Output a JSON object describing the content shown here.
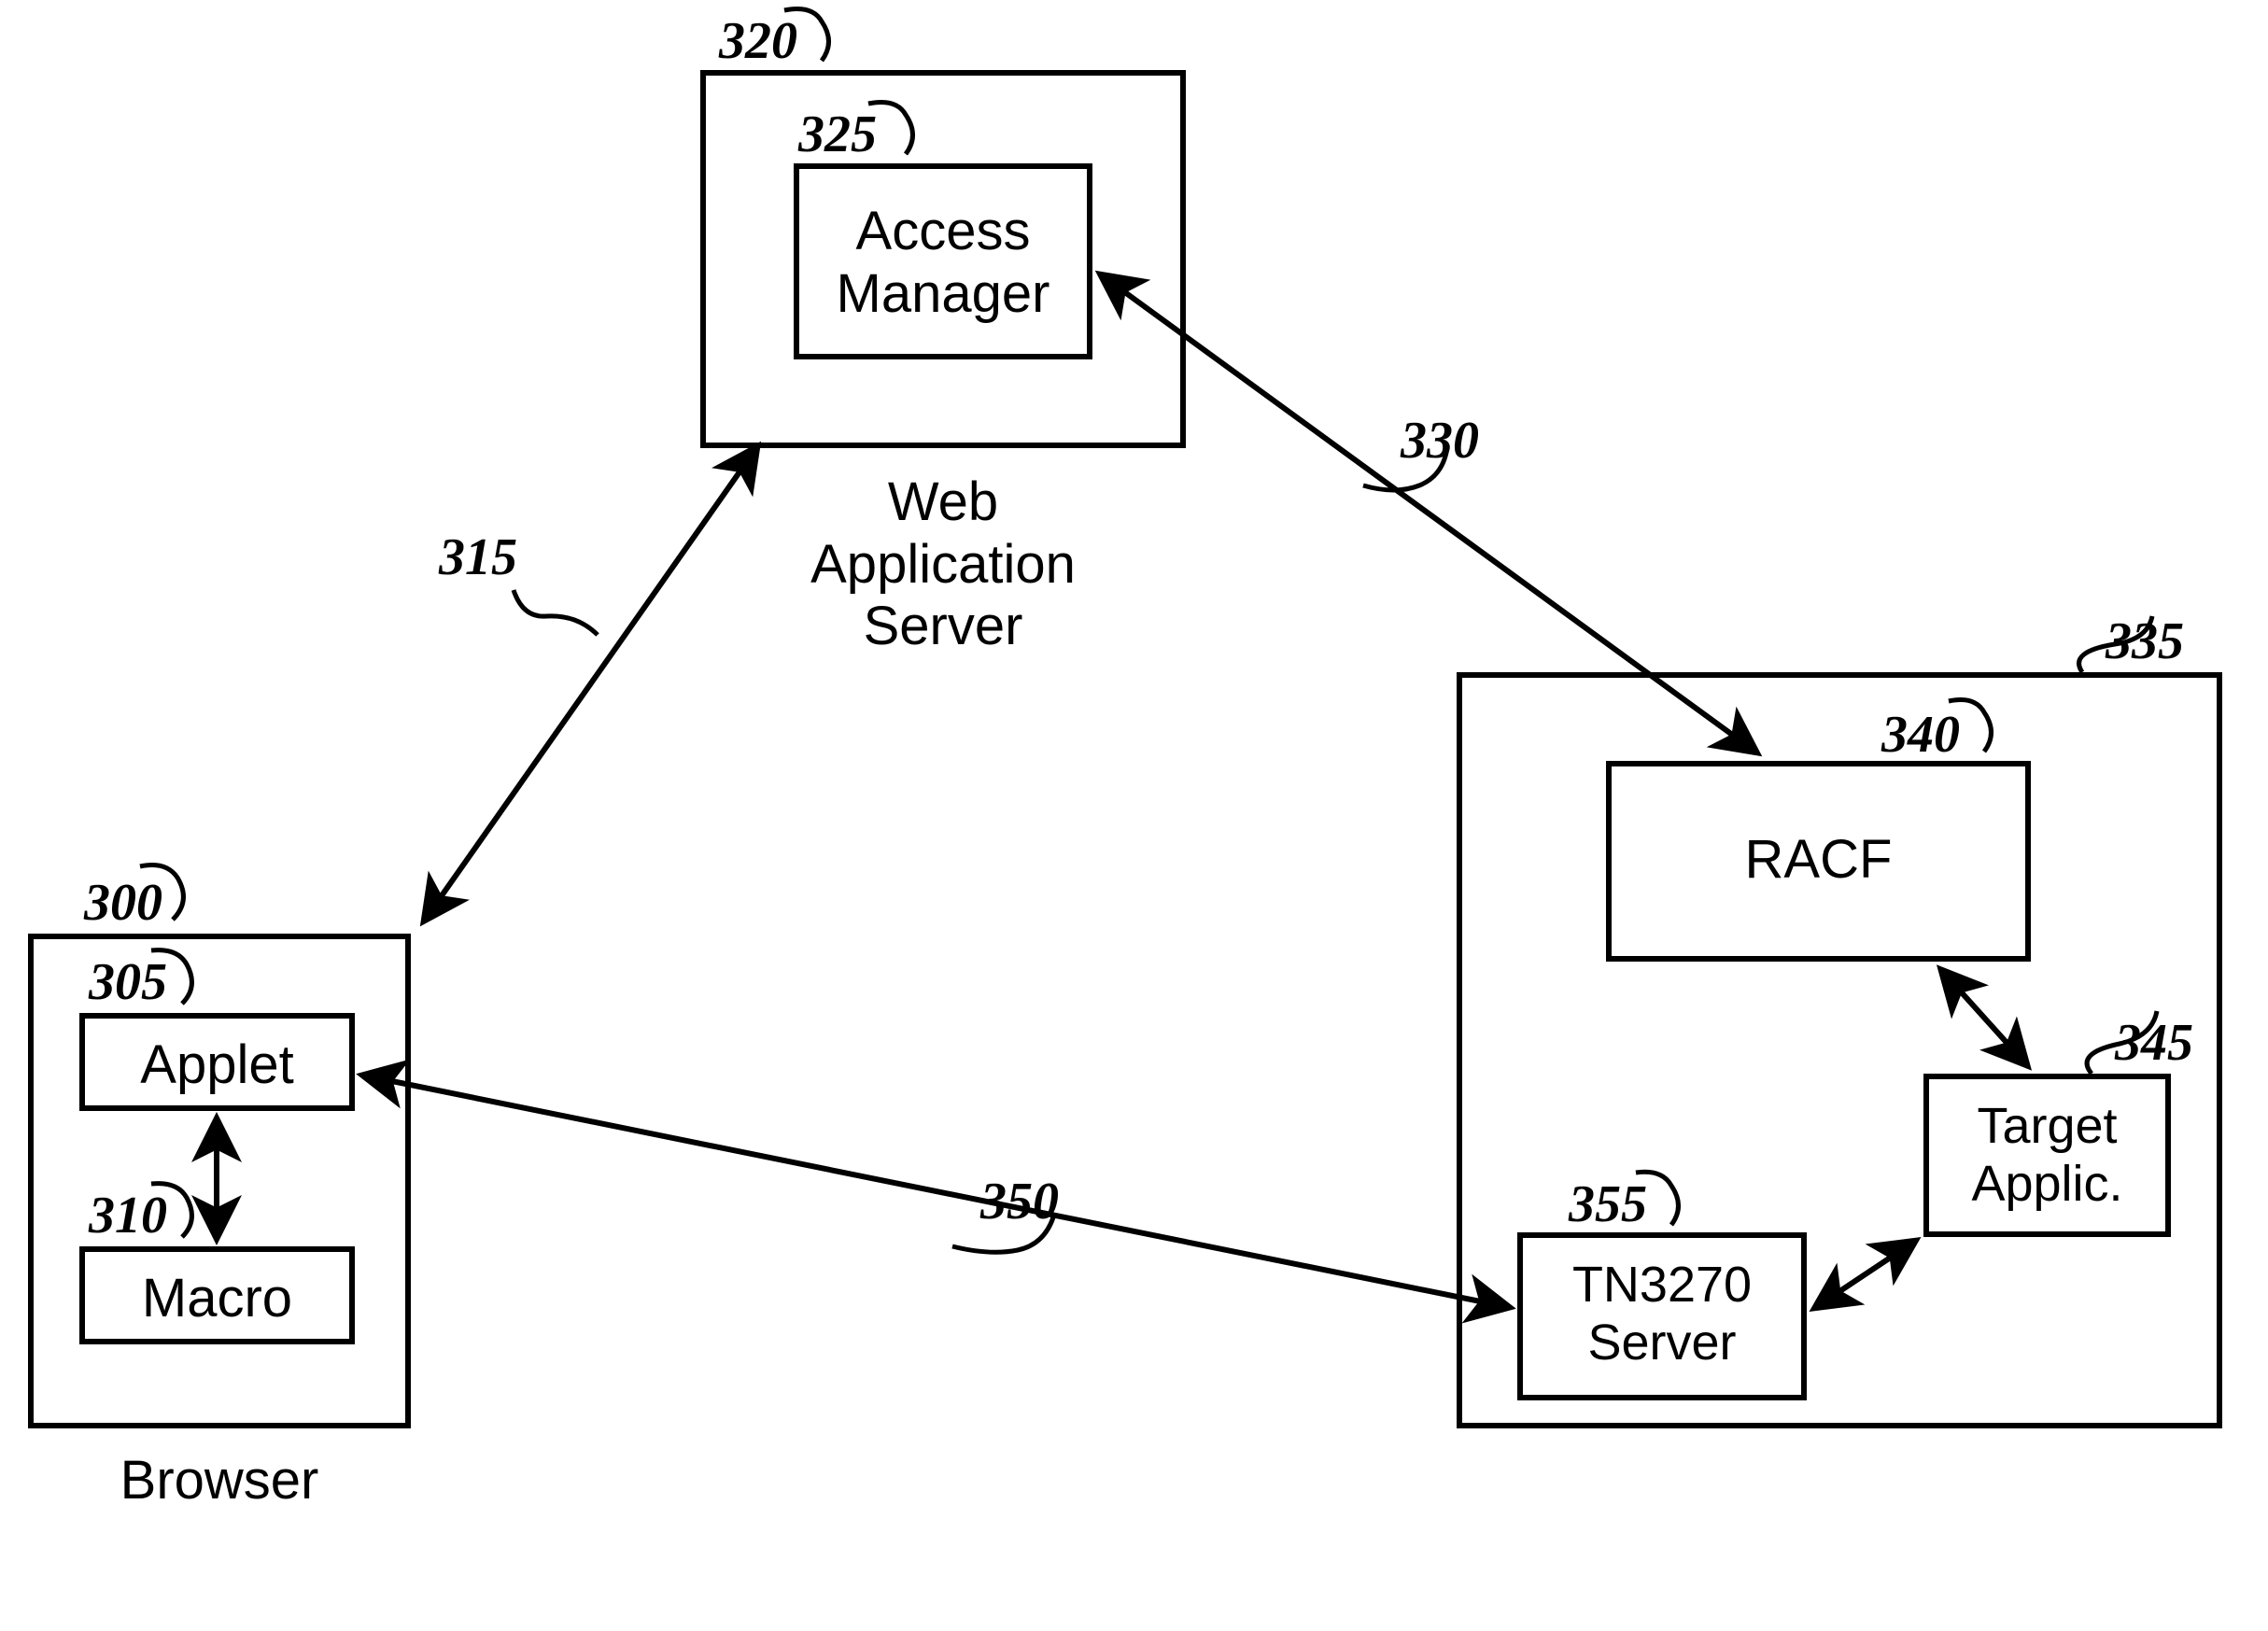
{
  "refs": {
    "browser_box": "300",
    "applet": "305",
    "macro": "310",
    "arrow_web": "315",
    "web_server_box": "320",
    "access_manager": "325",
    "arrow_racf": "330",
    "right_box": "335",
    "racf": "340",
    "target": "345",
    "arrow_tn3270": "350",
    "tn3270": "355"
  },
  "labels": {
    "browser_caption": "Browser",
    "applet": "Applet",
    "macro": "Macro",
    "web_caption": "Web\nApplication\nServer",
    "access_manager": "Access\nManager",
    "racf": "RACF",
    "target": "Target\nApplic.",
    "tn3270": "TN3270\nServer"
  }
}
